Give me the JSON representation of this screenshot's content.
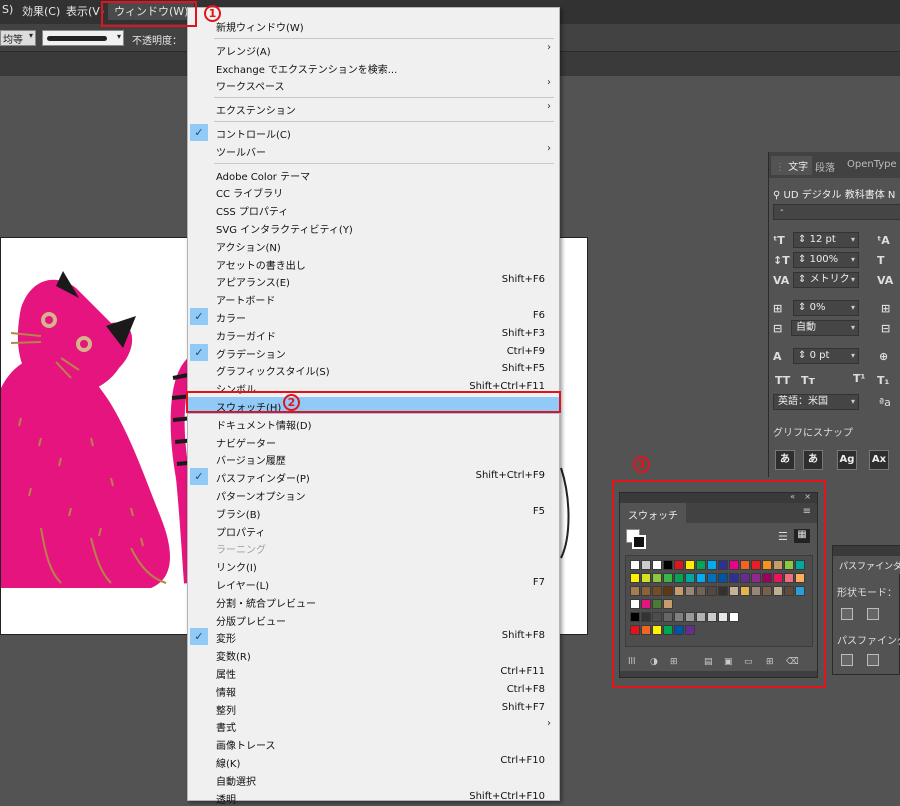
{
  "menubar": {
    "items": [
      {
        "label": "S)"
      },
      {
        "label": "効果(C)"
      },
      {
        "label": "表示(V)"
      },
      {
        "label": "ウィンドウ(W)"
      }
    ]
  },
  "controlbar": {
    "stroke_profile": "均等",
    "opacity_label": "不透明度："
  },
  "window_menu": {
    "items": [
      {
        "label": "新規ウィンドウ(W)",
        "shortcut": "",
        "checked": false,
        "submenu": false
      },
      {
        "sep": true
      },
      {
        "label": "アレンジ(A)",
        "shortcut": "",
        "checked": false,
        "submenu": true
      },
      {
        "label": "Exchange でエクステンションを検索...",
        "shortcut": "",
        "checked": false,
        "submenu": false
      },
      {
        "label": "ワークスペース",
        "shortcut": "",
        "checked": false,
        "submenu": true
      },
      {
        "sep": true
      },
      {
        "label": "エクステンション",
        "shortcut": "",
        "checked": false,
        "submenu": true
      },
      {
        "sep": true
      },
      {
        "label": "コントロール(C)",
        "shortcut": "",
        "checked": true,
        "submenu": false
      },
      {
        "label": "ツールバー",
        "shortcut": "",
        "checked": false,
        "submenu": true
      },
      {
        "sep": true
      },
      {
        "label": "Adobe Color テーマ",
        "shortcut": "",
        "checked": false,
        "submenu": false
      },
      {
        "label": "CC ライブラリ",
        "shortcut": "",
        "checked": false,
        "submenu": false
      },
      {
        "label": "CSS プロパティ",
        "shortcut": "",
        "checked": false,
        "submenu": false
      },
      {
        "label": "SVG インタラクティビティ(Y)",
        "shortcut": "",
        "checked": false,
        "submenu": false
      },
      {
        "label": "アクション(N)",
        "shortcut": "",
        "checked": false,
        "submenu": false
      },
      {
        "label": "アセットの書き出し",
        "shortcut": "",
        "checked": false,
        "submenu": false
      },
      {
        "label": "アピアランス(E)",
        "shortcut": "Shift+F6",
        "checked": false,
        "submenu": false
      },
      {
        "label": "アートボード",
        "shortcut": "",
        "checked": false,
        "submenu": false
      },
      {
        "label": "カラー",
        "shortcut": "F6",
        "checked": true,
        "submenu": false
      },
      {
        "label": "カラーガイド",
        "shortcut": "Shift+F3",
        "checked": false,
        "submenu": false
      },
      {
        "label": "グラデーション",
        "shortcut": "Ctrl+F9",
        "checked": true,
        "submenu": false
      },
      {
        "label": "グラフィックスタイル(S)",
        "shortcut": "Shift+F5",
        "checked": false,
        "submenu": false
      },
      {
        "label": "シンボル",
        "shortcut": "Shift+Ctrl+F11",
        "checked": false,
        "submenu": false
      },
      {
        "label": "スウォッチ(H)",
        "shortcut": "",
        "checked": false,
        "submenu": false,
        "highlighted": true
      },
      {
        "label": "ドキュメント情報(D)",
        "shortcut": "",
        "checked": false,
        "submenu": false
      },
      {
        "label": "ナビゲーター",
        "shortcut": "",
        "checked": false,
        "submenu": false
      },
      {
        "label": "バージョン履歴",
        "shortcut": "",
        "checked": false,
        "submenu": false
      },
      {
        "label": "パスファインダー(P)",
        "shortcut": "Shift+Ctrl+F9",
        "checked": true,
        "submenu": false
      },
      {
        "label": "パターンオプション",
        "shortcut": "",
        "checked": false,
        "submenu": false
      },
      {
        "label": "ブラシ(B)",
        "shortcut": "F5",
        "checked": false,
        "submenu": false
      },
      {
        "label": "プロパティ",
        "shortcut": "",
        "checked": false,
        "submenu": false
      },
      {
        "label": "ラーニング",
        "shortcut": "",
        "checked": false,
        "submenu": false,
        "disabled": true
      },
      {
        "label": "リンク(I)",
        "shortcut": "",
        "checked": false,
        "submenu": false
      },
      {
        "label": "レイヤー(L)",
        "shortcut": "F7",
        "checked": false,
        "submenu": false
      },
      {
        "label": "分割・統合プレビュー",
        "shortcut": "",
        "checked": false,
        "submenu": false
      },
      {
        "label": "分版プレビュー",
        "shortcut": "",
        "checked": false,
        "submenu": false
      },
      {
        "label": "変形",
        "shortcut": "Shift+F8",
        "checked": true,
        "submenu": false
      },
      {
        "label": "変数(R)",
        "shortcut": "",
        "checked": false,
        "submenu": false
      },
      {
        "label": "属性",
        "shortcut": "Ctrl+F11",
        "checked": false,
        "submenu": false
      },
      {
        "label": "情報",
        "shortcut": "Ctrl+F8",
        "checked": false,
        "submenu": false
      },
      {
        "label": "整列",
        "shortcut": "Shift+F7",
        "checked": false,
        "submenu": false
      },
      {
        "label": "書式",
        "shortcut": "",
        "checked": false,
        "submenu": true
      },
      {
        "label": "画像トレース",
        "shortcut": "",
        "checked": false,
        "submenu": false
      },
      {
        "label": "線(K)",
        "shortcut": "Ctrl+F10",
        "checked": false,
        "submenu": false
      },
      {
        "label": "自動選択",
        "shortcut": "",
        "checked": false,
        "submenu": false
      },
      {
        "label": "透明",
        "shortcut": "Shift+Ctrl+F10",
        "checked": false,
        "submenu": false
      }
    ]
  },
  "annotations": {
    "step1": "1",
    "step2": "2",
    "step3": "3"
  },
  "character_panel": {
    "tabs": [
      "文字",
      "段落",
      "OpenType"
    ],
    "font_name": "UD デジタル 教科書体 N",
    "font_style": "-",
    "font_size": "12 pt",
    "vertical_scale": "100%",
    "kerning": "メトリク",
    "tsume": "0%",
    "mojikumi": "自動",
    "baseline": "0 pt",
    "language": "英語：米国",
    "snap_label": "グリフにスナップ",
    "snap_buttons": [
      "あ",
      "あ",
      "Ag",
      "Ax"
    ]
  },
  "swatches_panel": {
    "title": "スウォッチ",
    "colors": {
      "magenta_cat": "#e5147f",
      "accent_red": "#e2141b",
      "highlight": "#91c9f7"
    }
  },
  "pathfinder_panel": {
    "title": "パスファインダー",
    "shape_mode_label": "形状モード：",
    "pathfinder_label": "パスファインダ"
  }
}
